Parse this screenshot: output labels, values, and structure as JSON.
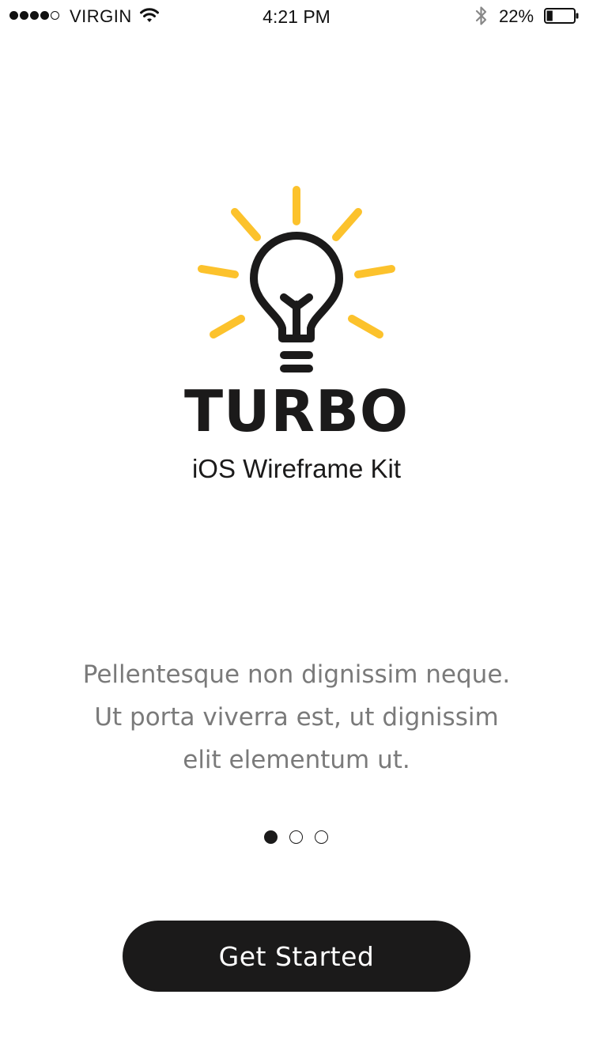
{
  "status_bar": {
    "signal_bars_filled": 4,
    "signal_bars_total": 5,
    "carrier": "VIRGIN",
    "wifi_icon": "wifi-icon",
    "time": "4:21 PM",
    "bluetooth_icon": "bluetooth-icon",
    "battery_percent": "22%",
    "battery_level": 0.22
  },
  "brand": {
    "logo_icon": "lightbulb-icon",
    "title": "TURBO",
    "subtitle": "iOS Wireframe Kit",
    "accent_color": "#FCC22C",
    "ink_color": "#1B1A1A"
  },
  "description": {
    "lines": [
      "Pellentesque non dignissim neque.",
      "Ut porta viverra est, ut dignissim",
      "elit elementum ut."
    ]
  },
  "pager": {
    "total_pages": 3,
    "current_page": 1
  },
  "cta": {
    "label": "Get Started"
  }
}
